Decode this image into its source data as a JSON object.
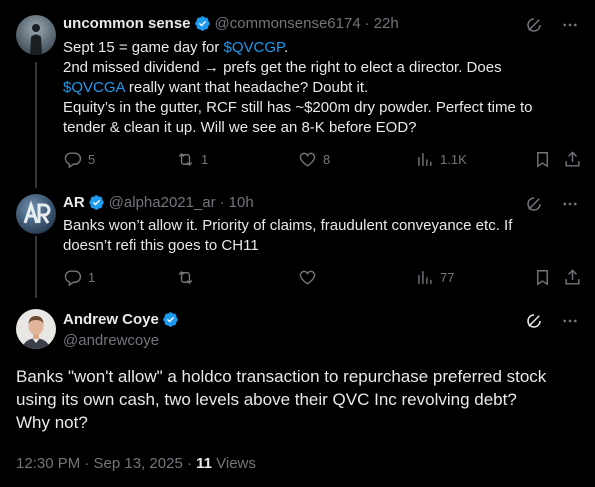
{
  "colors": {
    "background": "#000000",
    "text": "#e7e9ea",
    "muted": "#71767b",
    "accent": "#1d9bf0",
    "verified": "#1d9bf0"
  },
  "replies": [
    {
      "name": "uncommon sense",
      "handle": "@commonsense6174",
      "time": "22h",
      "avatar": "silhouette-avatar",
      "lines": [
        {
          "parts": [
            {
              "text": "Sept 15 = game day for "
            },
            {
              "text": "$QVCGP",
              "cashtag": true
            },
            {
              "text": "."
            }
          ]
        },
        {
          "parts": [
            {
              "text": "2nd missed dividend → prefs get the right to elect a director. Does"
            }
          ]
        },
        {
          "parts": [
            {
              "text": "$QVCGA",
              "cashtag": true
            },
            {
              "text": " really want that headache? Doubt it."
            }
          ]
        },
        {
          "parts": [
            {
              "text": "Equity’s in the gutter, RCF still has ~$200m dry powder. Perfect time to"
            }
          ]
        },
        {
          "parts": [
            {
              "text": "tender & clean it up. Will we see an 8-K before EOD?"
            }
          ]
        }
      ],
      "stats": {
        "replies": "5",
        "reposts": "1",
        "likes": "8",
        "views": "1.1K"
      }
    },
    {
      "name": "AR",
      "handle": "@alpha2021_ar",
      "time": "10h",
      "avatar": "ar-logo-avatar",
      "lines": [
        {
          "parts": [
            {
              "text": "Banks won’t allow it. Priority of claims, fraudulent conveyance etc. If"
            }
          ]
        },
        {
          "parts": [
            {
              "text": "doesn’t refi this goes to CH11"
            }
          ]
        }
      ],
      "stats": {
        "replies": "1",
        "reposts": "",
        "likes": "",
        "views": "77"
      }
    }
  ],
  "main": {
    "name": "Andrew Coye",
    "handle": "@andrewcoye",
    "avatar": "photo-avatar",
    "lines": [
      "Banks \"won't allow\" a holdco transaction to repurchase preferred stock",
      "using its own cash, two levels above their QVC Inc revolving debt?",
      "Why not?"
    ],
    "timestamp": "12:30 PM · Sep 13, 2025 · ",
    "views_count": "11",
    "views_label": " Views"
  }
}
